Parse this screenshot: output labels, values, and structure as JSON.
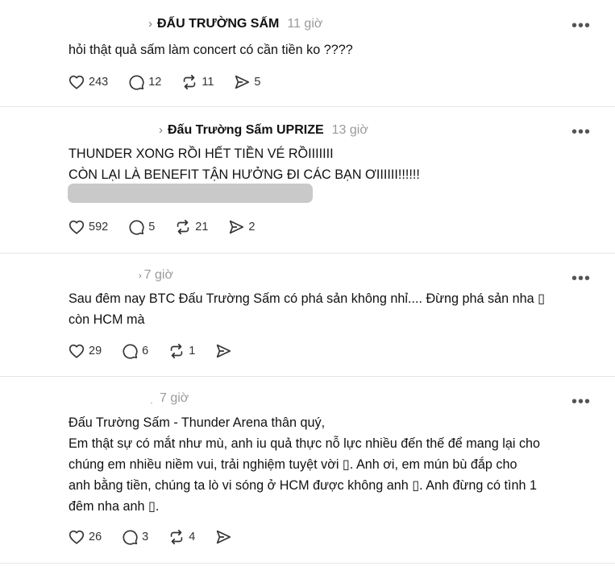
{
  "posts": [
    {
      "author": "ĐẤU TRƯỜNG SẤM",
      "time": "11 giờ",
      "lines": [
        "hỏi thật quả sấm làm concert có cần tiền ko ????"
      ],
      "likes": "243",
      "replies": "12",
      "reposts": "11",
      "shares": "5"
    },
    {
      "author": "Đấu Trường Sấm UPRIZE",
      "time": "13 giờ",
      "lines": [
        "THUNDER XONG RỒI HẾT TIỀN VÉ RỒIIIIIII",
        "CÒN LẠI LÀ BENEFIT TẬN HƯỞNG ĐI CÁC BẠN ƠIIIIII!!!!!!"
      ],
      "likes": "592",
      "replies": "5",
      "reposts": "21",
      "shares": "2"
    },
    {
      "author": "",
      "time": "7 giờ",
      "lines": [
        "Sau đêm nay BTC Đấu Trường Sấm có phá sản không nhỉ.... Đừng phá sản nha ▯",
        "còn HCM mà"
      ],
      "likes": "29",
      "replies": "6",
      "reposts": "1",
      "shares": ""
    },
    {
      "author": "",
      "time": "7 giờ",
      "lines": [
        "Đấu Trường Sấm - Thunder Arena thân quý,",
        "Em thật sự có mắt như mù, anh iu quả thực nỗ lực nhiều đến thế để mang lại cho",
        "chúng em nhiều niềm vui, trải nghiệm tuyệt vời ▯. Anh ơi, em mún bù đắp cho",
        "anh bằng tiền, chúng ta lò vi sóng ở HCM được không anh ▯. Anh đừng có tình 1",
        "đêm nha anh ▯."
      ],
      "likes": "26",
      "replies": "3",
      "reposts": "4",
      "shares": ""
    }
  ],
  "icons": {
    "more": "more-horizontal-icon",
    "like": "heart-icon",
    "reply": "comment-bubble-icon",
    "repost": "repost-arrows-icon",
    "share": "send-arrow-icon"
  },
  "colors": {
    "text": "#111111",
    "muted": "#9a9a9a",
    "divider": "#e6e6e6",
    "blur": "#c9c9c9"
  }
}
